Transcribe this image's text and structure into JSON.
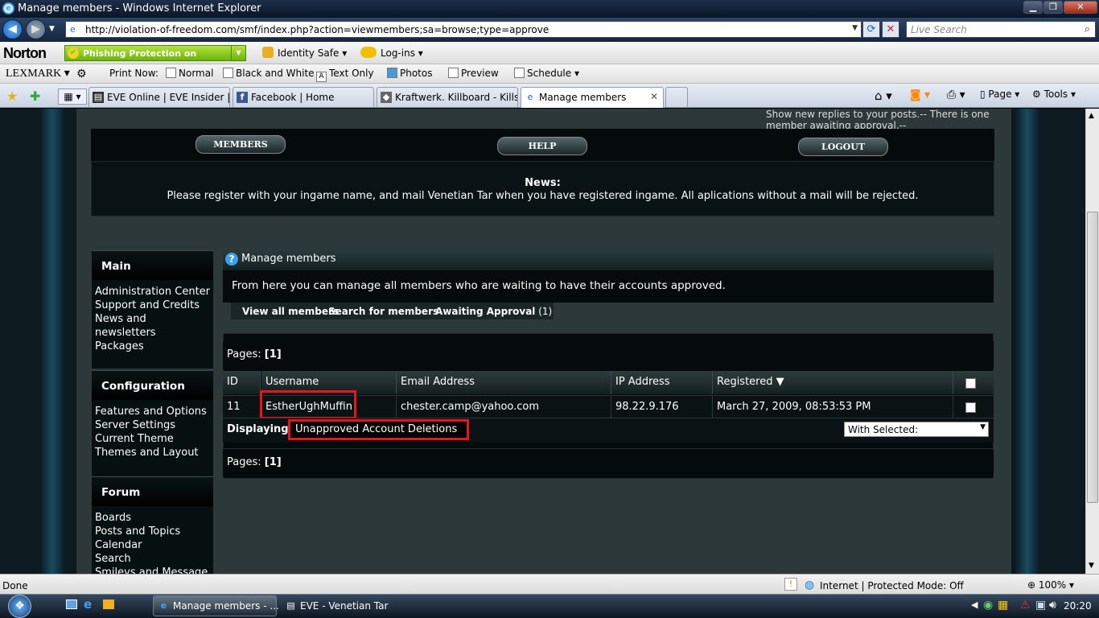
{
  "window": {
    "title": "Manage members - Windows Internet Explorer",
    "minimize": "▁",
    "maximize": "❐",
    "close": "✕"
  },
  "address": {
    "url": "http://violation-of-freedom.com/smf/index.php?action=viewmembers;sa=browse;type=approve",
    "search_placeholder": "Live Search"
  },
  "norton": {
    "logo": "Norton",
    "phishing": "Phishing Protection on",
    "identity": "Identity Safe",
    "logins": "Log-ins"
  },
  "lexmark": {
    "logo": "LEXMARK",
    "print_now": "Print Now:",
    "normal": "Normal",
    "bw": "Black and White",
    "text_only": "Text Only",
    "photos": "Photos",
    "preview": "Preview",
    "schedule": "Schedule"
  },
  "tabs": [
    {
      "label": "EVE Online | EVE Insider | F..."
    },
    {
      "label": "Facebook | Home"
    },
    {
      "label": "Kraftwerk. Killboard - Kills ..."
    },
    {
      "label": "Manage members"
    }
  ],
  "commandbar": {
    "page": "Page",
    "tools": "Tools"
  },
  "forum": {
    "top_text": "Show new replies to your posts.-- There is one member awaiting approval.--",
    "menu": {
      "members": "MEMBERS",
      "help": "HELP",
      "logout": "LOGOUT"
    },
    "news_heading": "News:",
    "news_text": "Please register with your ingame name, and mail Venetian Tar when you have registered ingame. All aplications without a mail will be rejected."
  },
  "sidebar": {
    "main": {
      "title": "Main",
      "items": [
        "Administration Center",
        "Support and Credits",
        "News and",
        "newsletters",
        "Packages"
      ]
    },
    "config": {
      "title": "Configuration",
      "items": [
        "Features and Options",
        "Server Settings",
        "Current Theme",
        "Themes and Layout"
      ]
    },
    "forum": {
      "title": "Forum",
      "items": [
        "Boards",
        "Posts and Topics",
        "Calendar",
        "Search",
        "Smileys and Message"
      ]
    }
  },
  "manage": {
    "title": "Manage members",
    "description": "From here you can manage all members who are waiting to have their accounts approved.",
    "tab_view_all": "View all members",
    "tab_search": "Search for members",
    "tab_awaiting": "Awaiting Approval",
    "tab_awaiting_count": "(1)",
    "pages_label": "Pages:",
    "pages_value": "[1]",
    "columns": {
      "id": "ID",
      "username": "Username",
      "email": "Email Address",
      "ip": "IP Address",
      "registered": "Registered"
    },
    "sort_arrow": "▼",
    "rows": [
      {
        "id": "11",
        "username": "EstherUghMuffin",
        "email": "chester.camp@yahoo.com",
        "ip": "98.22.9.176",
        "registered": "March 27, 2009, 08:53:53 PM"
      }
    ],
    "displaying_label": "Displaying",
    "displaying_value": "Unapproved Account Deletions",
    "with_selected": "With Selected:"
  },
  "statusbar": {
    "left": "Done",
    "zone": "Internet | Protected Mode: Off",
    "zoom": "100%"
  },
  "taskbar": {
    "items": [
      "Manage members - ...",
      "EVE - Venetian Tar"
    ],
    "clock": "20:20"
  },
  "colors": {
    "highlight": "#e8141e",
    "page_bg": "#2c3839"
  }
}
